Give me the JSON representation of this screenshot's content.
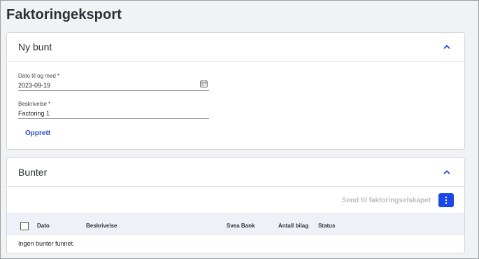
{
  "page": {
    "title": "Faktoringeksport"
  },
  "new_batch": {
    "title": "Ny bunt",
    "date_field": {
      "label": "Dato til og med *",
      "value": "2023-09-19"
    },
    "description_field": {
      "label": "Beskrivelse *",
      "value": "Factoring 1"
    },
    "create_label": "Opprett"
  },
  "batches": {
    "title": "Bunter",
    "send_label": "Send til faktoringselskapet",
    "columns": [
      "Dato",
      "Beskrivelse",
      "Svea Bank",
      "Antall bilag",
      "Status"
    ],
    "empty_message": "Ingen bunter funnet."
  },
  "colors": {
    "accent": "#1a47e6",
    "link": "#2d4cc8",
    "disabled": "#b9bcc2"
  },
  "icons": [
    "chevron-up-icon",
    "calendar-icon",
    "more-vertical-icon"
  ]
}
